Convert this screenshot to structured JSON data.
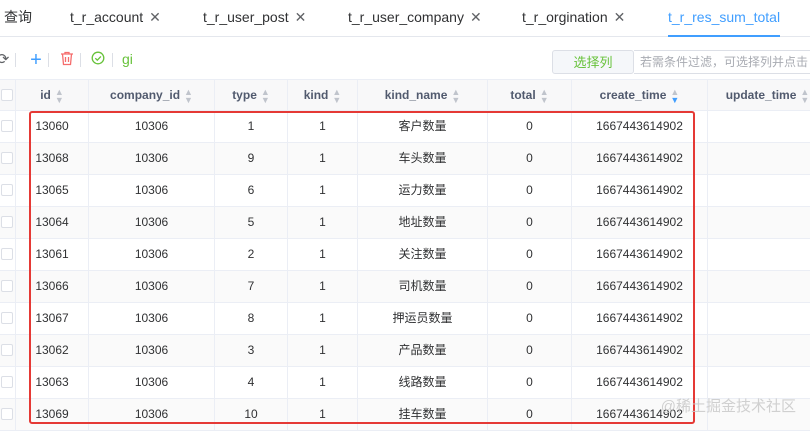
{
  "tabs": [
    {
      "label": "查询",
      "closable": false,
      "active": false
    },
    {
      "label": "t_r_account",
      "closable": true,
      "active": false
    },
    {
      "label": "t_r_user_post",
      "closable": true,
      "active": false
    },
    {
      "label": "t_r_user_company",
      "closable": true,
      "active": false
    },
    {
      "label": "t_r_orgination",
      "closable": true,
      "active": false
    },
    {
      "label": "t_r_res_sum_total",
      "closable": false,
      "active": true
    }
  ],
  "toolbar": {
    "gi_label": "gi",
    "select_columns_label": "选择列",
    "filter_placeholder": "若需条件过滤，可选择列并点击"
  },
  "table": {
    "columns": [
      "id",
      "company_id",
      "type",
      "kind",
      "kind_name",
      "total",
      "create_time",
      "update_time"
    ],
    "active_sort_column": "create_time",
    "rows": [
      [
        "13060",
        "10306",
        "1",
        "1",
        "客户数量",
        "0",
        "1667443614902",
        ""
      ],
      [
        "13068",
        "10306",
        "9",
        "1",
        "车头数量",
        "0",
        "1667443614902",
        ""
      ],
      [
        "13065",
        "10306",
        "6",
        "1",
        "运力数量",
        "0",
        "1667443614902",
        ""
      ],
      [
        "13064",
        "10306",
        "5",
        "1",
        "地址数量",
        "0",
        "1667443614902",
        ""
      ],
      [
        "13061",
        "10306",
        "2",
        "1",
        "关注数量",
        "0",
        "1667443614902",
        ""
      ],
      [
        "13066",
        "10306",
        "7",
        "1",
        "司机数量",
        "0",
        "1667443614902",
        ""
      ],
      [
        "13067",
        "10306",
        "8",
        "1",
        "押运员数量",
        "0",
        "1667443614902",
        ""
      ],
      [
        "13062",
        "10306",
        "3",
        "1",
        "产品数量",
        "0",
        "1667443614902",
        ""
      ],
      [
        "13063",
        "10306",
        "4",
        "1",
        "线路数量",
        "0",
        "1667443614902",
        ""
      ],
      [
        "13069",
        "10306",
        "10",
        "1",
        "挂车数量",
        "0",
        "1667443614902",
        ""
      ]
    ]
  },
  "watermark": "@稀土掘金技术社区",
  "colors": {
    "accent": "#409eff",
    "danger": "#f56c6c",
    "success": "#67c23a",
    "highlight": "#e53935"
  },
  "icons": {
    "refresh": "refresh-icon",
    "add": "plus-icon",
    "delete": "trash-icon",
    "confirm": "check-circle-icon",
    "close": "close-icon"
  }
}
